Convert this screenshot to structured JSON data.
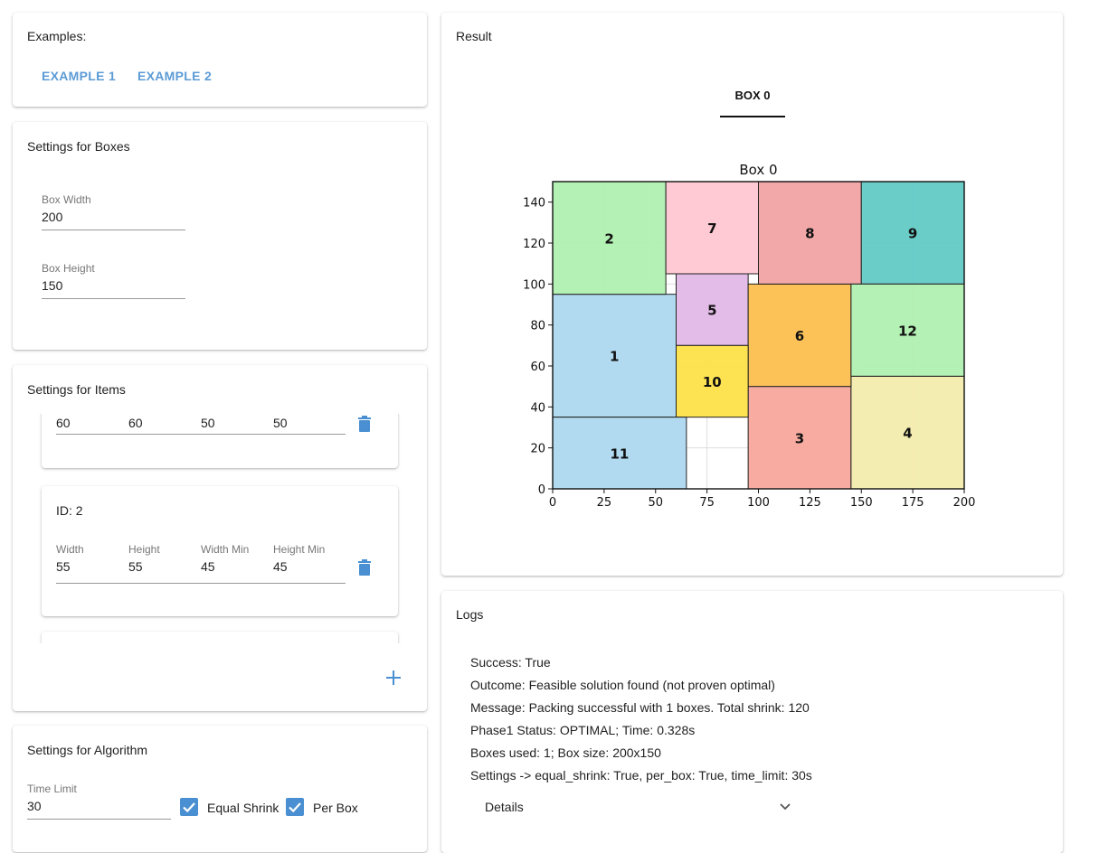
{
  "examples": {
    "title": "Examples:",
    "buttons": [
      "EXAMPLE 1",
      "EXAMPLE 2"
    ]
  },
  "boxes": {
    "title": "Settings for Boxes",
    "width_label": "Box Width",
    "width_value": "200",
    "height_label": "Box Height",
    "height_value": "150"
  },
  "items": {
    "title": "Settings for Items",
    "partial_row": [
      "60",
      "60",
      "50",
      "50"
    ],
    "item2": {
      "id_label": "ID: 2",
      "headers": [
        "Width",
        "Height",
        "Width Min",
        "Height Min"
      ],
      "values": [
        "55",
        "55",
        "45",
        "45"
      ]
    },
    "add_icon": "plus-icon",
    "delete_icon": "trash-icon"
  },
  "algorithm": {
    "title": "Settings for Algorithm",
    "time_label": "Time Limit",
    "time_value": "30",
    "equal_shrink_label": "Equal Shrink",
    "equal_shrink_checked": true,
    "per_box_label": "Per Box",
    "per_box_checked": true
  },
  "result": {
    "title": "Result",
    "tab": "BOX 0"
  },
  "logs": {
    "title": "Logs",
    "lines": [
      "Success: True",
      "Outcome: Feasible solution found (not proven optimal)",
      "Message: Packing successful with 1 boxes. Total shrink: 120",
      "Phase1 Status: OPTIMAL; Time: 0.328s",
      "Boxes used: 1; Box size: 200x150",
      "Settings -> equal_shrink: True, per_box: True, time_limit: 30s"
    ],
    "details_label": "Details"
  },
  "colors": {
    "accent": "#5b9bd5",
    "checkbox": "#4a8fd1"
  },
  "chart_data": {
    "type": "rectangles",
    "title": "Box 0",
    "xlim": [
      0,
      200
    ],
    "ylim": [
      0,
      150
    ],
    "xticks": [
      0,
      25,
      50,
      75,
      100,
      125,
      150,
      175,
      200
    ],
    "yticks": [
      0,
      20,
      40,
      60,
      80,
      100,
      120,
      140
    ],
    "rects": [
      {
        "id": "1",
        "x": 0,
        "y": 35,
        "w": 60,
        "h": 60,
        "color": "#add8ef"
      },
      {
        "id": "2",
        "x": 0,
        "y": 95,
        "w": 55,
        "h": 55,
        "color": "#b0f0b0"
      },
      {
        "id": "3",
        "x": 95,
        "y": 0,
        "w": 50,
        "h": 50,
        "color": "#f8a89c"
      },
      {
        "id": "4",
        "x": 145,
        "y": 0,
        "w": 55,
        "h": 55,
        "color": "#f3ecad"
      },
      {
        "id": "5",
        "x": 60,
        "y": 70,
        "w": 35,
        "h": 35,
        "color": "#e2b8e6"
      },
      {
        "id": "6",
        "x": 95,
        "y": 50,
        "w": 50,
        "h": 50,
        "color": "#fcbf4f"
      },
      {
        "id": "7",
        "x": 55,
        "y": 105,
        "w": 45,
        "h": 45,
        "color": "#ffc7d2"
      },
      {
        "id": "8",
        "x": 100,
        "y": 100,
        "w": 50,
        "h": 50,
        "color": "#f1a3a3"
      },
      {
        "id": "9",
        "x": 150,
        "y": 100,
        "w": 50,
        "h": 50,
        "color": "#63cac5"
      },
      {
        "id": "10",
        "x": 60,
        "y": 35,
        "w": 35,
        "h": 35,
        "color": "#fde048"
      },
      {
        "id": "11",
        "x": 0,
        "y": 0,
        "w": 65,
        "h": 35,
        "color": "#add8ef"
      },
      {
        "id": "12",
        "x": 145,
        "y": 55,
        "w": 55,
        "h": 45,
        "color": "#b0f0b0"
      }
    ]
  }
}
